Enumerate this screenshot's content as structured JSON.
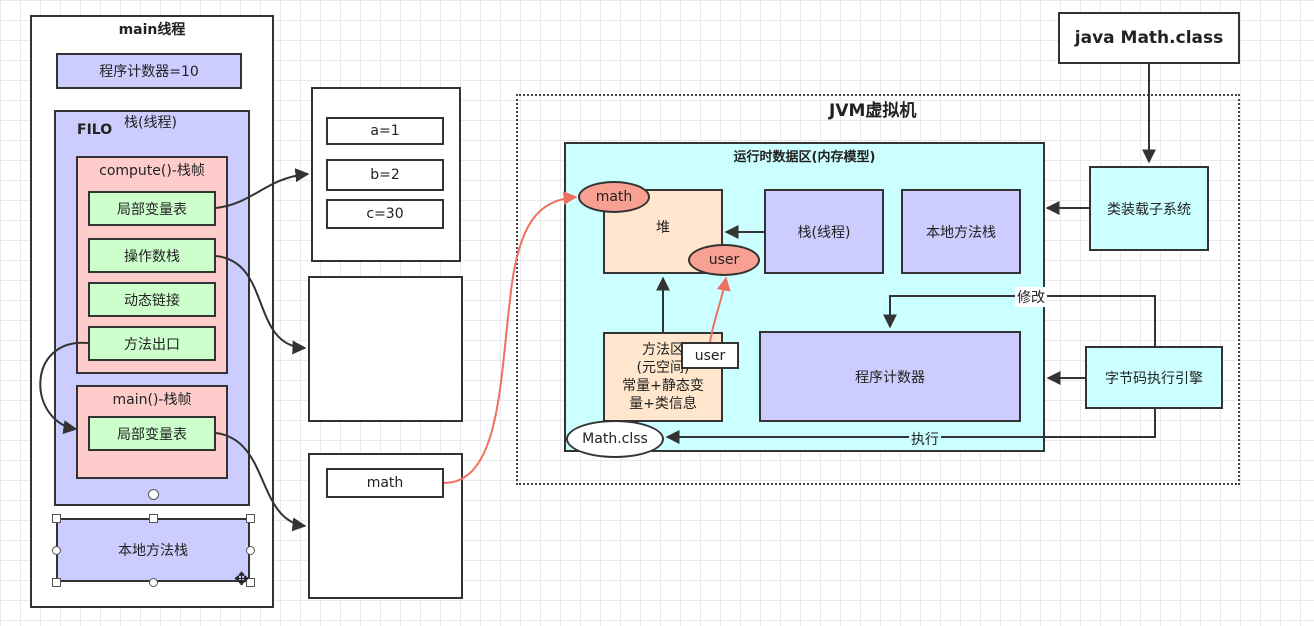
{
  "main_thread": {
    "title": "main线程",
    "program_counter": "程序计数器=10",
    "stack_title": "栈(线程)",
    "filo": "FILO",
    "compute_frame": {
      "title": "compute()-栈帧",
      "local_vars": "局部变量表",
      "operand_stack": "操作数栈",
      "dynamic_link": "动态链接",
      "method_exit": "方法出口"
    },
    "main_frame": {
      "title": "main()-栈帧",
      "local_vars": "局部变量表"
    },
    "native_stack": "本地方法栈"
  },
  "vars_box": {
    "a": "a=1",
    "b": "b=2",
    "c": "c=30"
  },
  "main_vars_box": {
    "math": "math"
  },
  "java_cmd": "java Math.class",
  "jvm": {
    "title": "JVM虚拟机",
    "runtime_area": {
      "title": "运行时数据区(内存模型)",
      "heap": "堆",
      "heap_math": "math",
      "heap_user": "user",
      "stack": "栈(线程)",
      "native_stack": "本地方法栈",
      "method_area": "方法区\n(元空间)\n常量+静态变\n量+类信息",
      "method_area_user": "user",
      "program_counter": "程序计数器",
      "math_class": "Math.clss"
    },
    "class_loader": "类装载子系统",
    "bytecode_engine": "字节码执行引擎",
    "modify_label": "修改",
    "execute_label": "执行"
  },
  "colors": {
    "purple_fill": "#ccccff",
    "pink_fill": "#ffcccc",
    "green_fill": "#ccffcc",
    "cyan_fill": "#ccffff",
    "peach_fill": "#ffe6cc",
    "salmon_fill": "#f8a192",
    "red_arrow": "#f07060"
  }
}
